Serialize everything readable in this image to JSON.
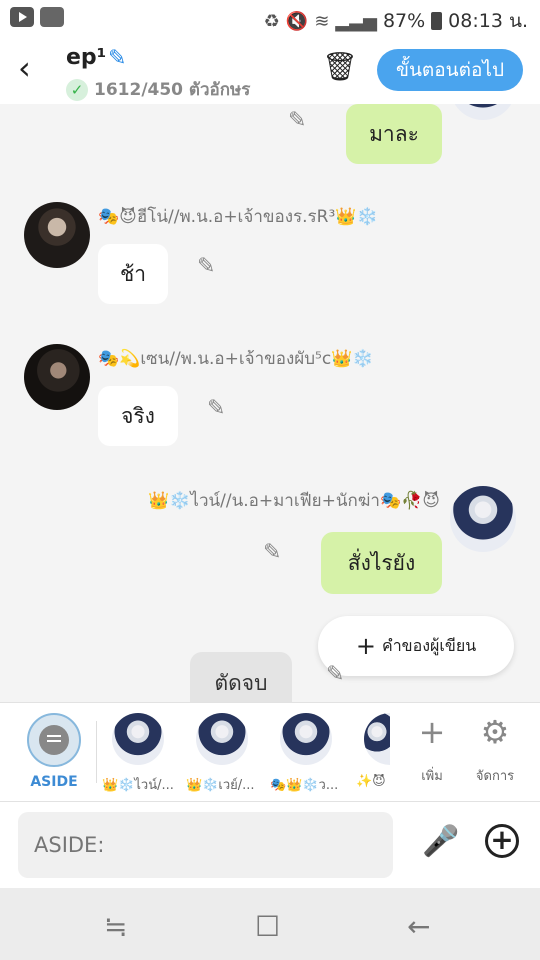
{
  "status_bar": {
    "battery": "87%",
    "time": "08:13 น."
  },
  "header": {
    "back_icon": "chevron-left-icon",
    "title": "ep¹",
    "char_count": "1612/450 ตัวอักษร",
    "next_label": "ขั้นตอนต่อไป",
    "accent": "#4aa4ee"
  },
  "chat": {
    "messages": [
      {
        "name": "",
        "text": "มาละ",
        "side": "right",
        "color": "#d6f2a8"
      },
      {
        "name": "🎭😈ฮีโน่//พ.น.อ+เจ้าของร.รR³👑❄️",
        "text": "ช้า",
        "side": "left",
        "color": "#ffffff"
      },
      {
        "name": "🎭💫เซน//พ.น.อ+เจ้าของผับ⁵c👑❄️",
        "text": "จริง",
        "side": "left",
        "color": "#ffffff"
      },
      {
        "name": "👑❄️ไวน์//น.อ+มาเฟีย+นักฆ่า🎭🥀😈",
        "text": "สั่งไรยัง",
        "side": "right",
        "color": "#d6f2a8"
      },
      {
        "name": "",
        "text": "ตัดจบ",
        "side": "center",
        "color": "#e4e4e4"
      }
    ],
    "author_button": "คำของผู้เขียน"
  },
  "characters": {
    "aside_label": "ASIDE",
    "list": [
      {
        "label": "👑❄️ไวน์/..."
      },
      {
        "label": "👑❄️เวย์/..."
      },
      {
        "label": "🎭👑❄️ว..."
      },
      {
        "label": "✨😈"
      }
    ],
    "add_label": "เพิ่ม",
    "manage_label": "จัดการ"
  },
  "input": {
    "placeholder": "ASIDE:"
  }
}
